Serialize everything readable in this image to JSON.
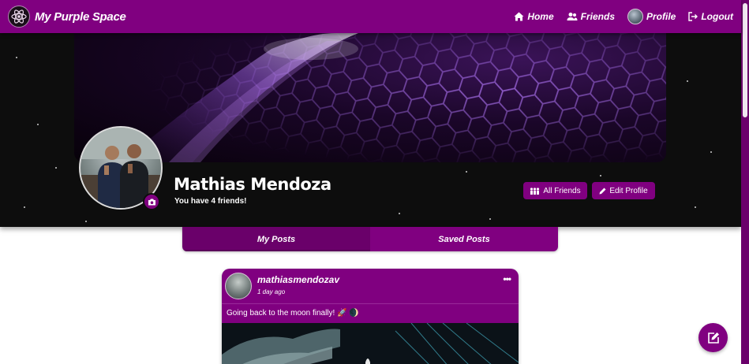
{
  "navbar": {
    "brand": "My Purple Space",
    "links": [
      {
        "label": "Home",
        "icon": "home-icon"
      },
      {
        "label": "Friends",
        "icon": "friends-icon"
      },
      {
        "label": "Profile",
        "icon": "avatar"
      },
      {
        "label": "Logout",
        "icon": "logout-icon"
      }
    ]
  },
  "profile": {
    "name": "Mathias Mendoza",
    "friends_text": "You have 4 friends!",
    "all_friends_label": "All Friends",
    "edit_profile_label": "Edit Profile"
  },
  "tabs": [
    {
      "label": "My Posts",
      "active": true
    },
    {
      "label": "Saved Posts",
      "active": false
    }
  ],
  "post": {
    "username": "mathiasmendozav",
    "time": "1 day ago",
    "menu": "•••",
    "text": "Going back to the moon finally! 🚀 🌒"
  },
  "colors": {
    "primary": "#800080",
    "header_bg": "#0d0d0d",
    "page_bg": "#ffffff"
  }
}
